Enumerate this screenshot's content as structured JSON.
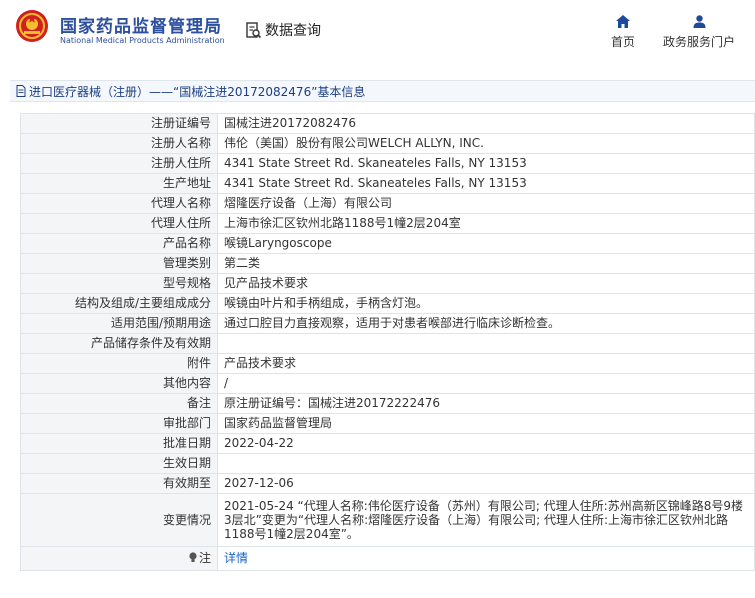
{
  "header": {
    "logo_cn": "国家药品监督管理局",
    "logo_en": "National Medical Products Administration",
    "query_label": "数据查询",
    "nav_home": "首页",
    "nav_gov": "政务服务门户"
  },
  "breadcrumb": "进口医疗器械（注册）——“国械注进20172082476”基本信息",
  "rows": [
    {
      "label": "注册证编号",
      "value": "国械注进20172082476"
    },
    {
      "label": "注册人名称",
      "value": "伟伦（美国）股份有限公司WELCH ALLYN, INC."
    },
    {
      "label": "注册人住所",
      "value": "4341 State Street Rd. Skaneateles Falls, NY 13153"
    },
    {
      "label": "生产地址",
      "value": "4341 State Street Rd. Skaneateles Falls, NY 13153"
    },
    {
      "label": "代理人名称",
      "value": "熠隆医疗设备（上海）有限公司"
    },
    {
      "label": "代理人住所",
      "value": "上海市徐汇区钦州北路1188号1幢2层204室"
    },
    {
      "label": "产品名称",
      "value": "喉镜Laryngoscope"
    },
    {
      "label": "管理类别",
      "value": "第二类"
    },
    {
      "label": "型号规格",
      "value": "见产品技术要求"
    },
    {
      "label": "结构及组成/主要组成成分",
      "value": "喉镜由叶片和手柄组成，手柄含灯泡。"
    },
    {
      "label": "适用范围/预期用途",
      "value": "通过口腔目力直接观察，适用于对患者喉部进行临床诊断检查。"
    },
    {
      "label": "产品储存条件及有效期",
      "value": ""
    },
    {
      "label": "附件",
      "value": "产品技术要求"
    },
    {
      "label": "其他内容",
      "value": "/"
    },
    {
      "label": "备注",
      "value": "原注册证编号：国械注进20172222476"
    },
    {
      "label": "审批部门",
      "value": "国家药品监督管理局"
    },
    {
      "label": "批准日期",
      "value": "2022-04-22"
    },
    {
      "label": "生效日期",
      "value": ""
    },
    {
      "label": "有效期至",
      "value": "2027-12-06"
    }
  ],
  "change": {
    "label": "变更情况",
    "value": "2021-05-24 “代理人名称:伟伦医疗设备（苏州）有限公司; 代理人住所:苏州高新区锦峰路8号9楼3层北”变更为“代理人名称:熠隆医疗设备（上海）有限公司; 代理人住所:上海市徐汇区钦州北路1188号1幢2层204室”。"
  },
  "note": {
    "label": "注",
    "link": "详情"
  },
  "colors": {
    "brand": "#2c4f9e",
    "link": "#1a64c8",
    "key_bg": "#f4f5f7",
    "border": "#dfe3ea"
  },
  "icons": [
    "emblem-icon",
    "search-document-icon",
    "home-icon",
    "user-icon",
    "document-icon",
    "bulb-icon"
  ]
}
